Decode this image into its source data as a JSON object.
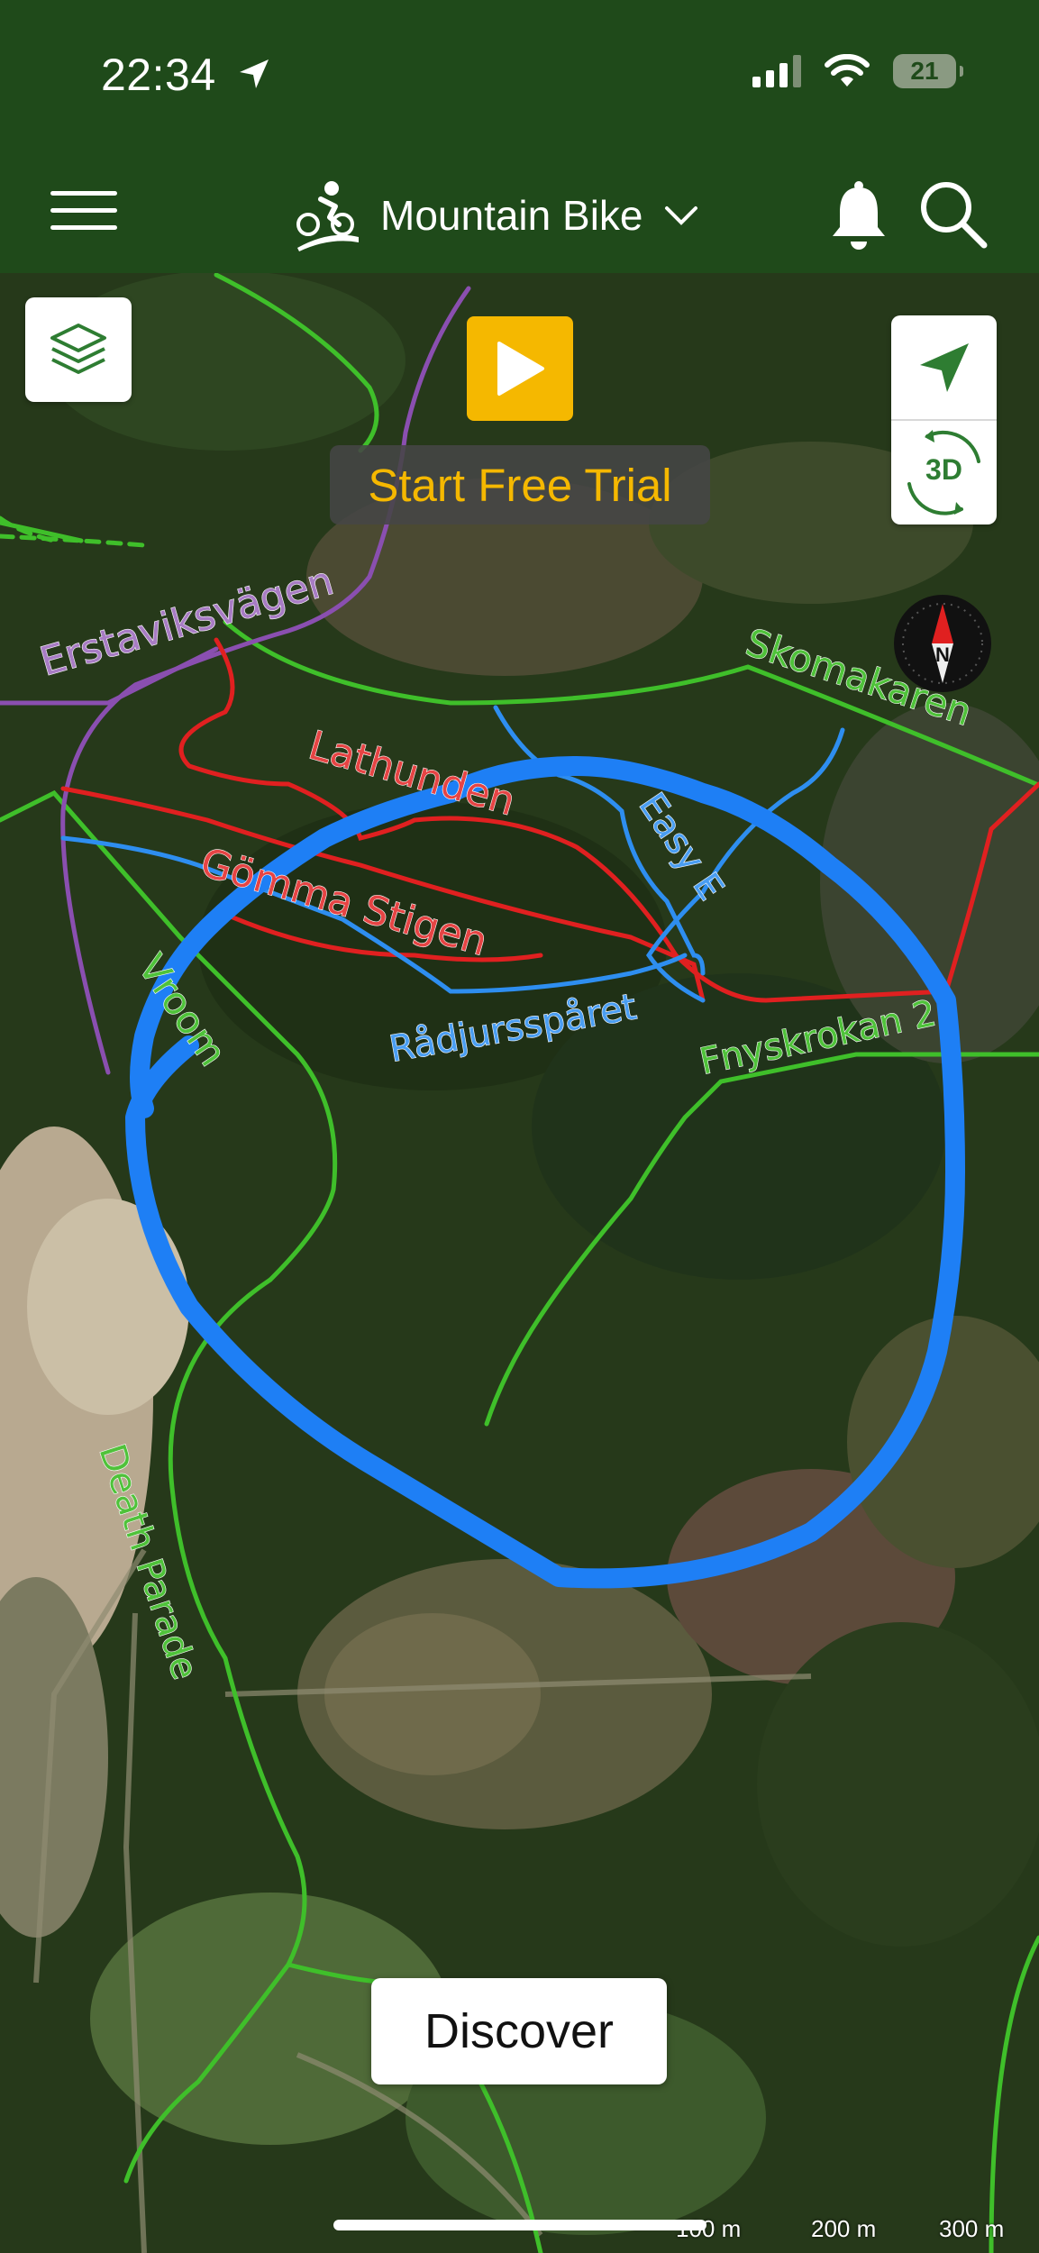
{
  "status_bar": {
    "time": "22:34",
    "battery": "21"
  },
  "header": {
    "activity": "Mountain Bike"
  },
  "map": {
    "trial_button_label": "Start Free Trial",
    "three_d_label": "3D",
    "compass_label": "N",
    "discover_label": "Discover",
    "scale_labels": [
      "100 m",
      "200 m",
      "300 m"
    ],
    "trail_labels": {
      "erstaviksvagen": "Erstaviksvägen",
      "skomakaren": "Skomakaren",
      "lathunden": "Lathunden",
      "easy_e": "Easy E",
      "gomma_stigen": "Gömma Stigen",
      "vroom": "Vroom",
      "radjursparet": "Rådjursspåret",
      "fryskrokan": "Fnyskrokan 2",
      "death_parade": "Death Parade"
    },
    "trail_colors": {
      "green": "#3fbf2a",
      "red": "#e02020",
      "blue": "#2e8ef0",
      "purple": "#8a4fb0",
      "drawn_route": "#1e7ff5"
    }
  }
}
